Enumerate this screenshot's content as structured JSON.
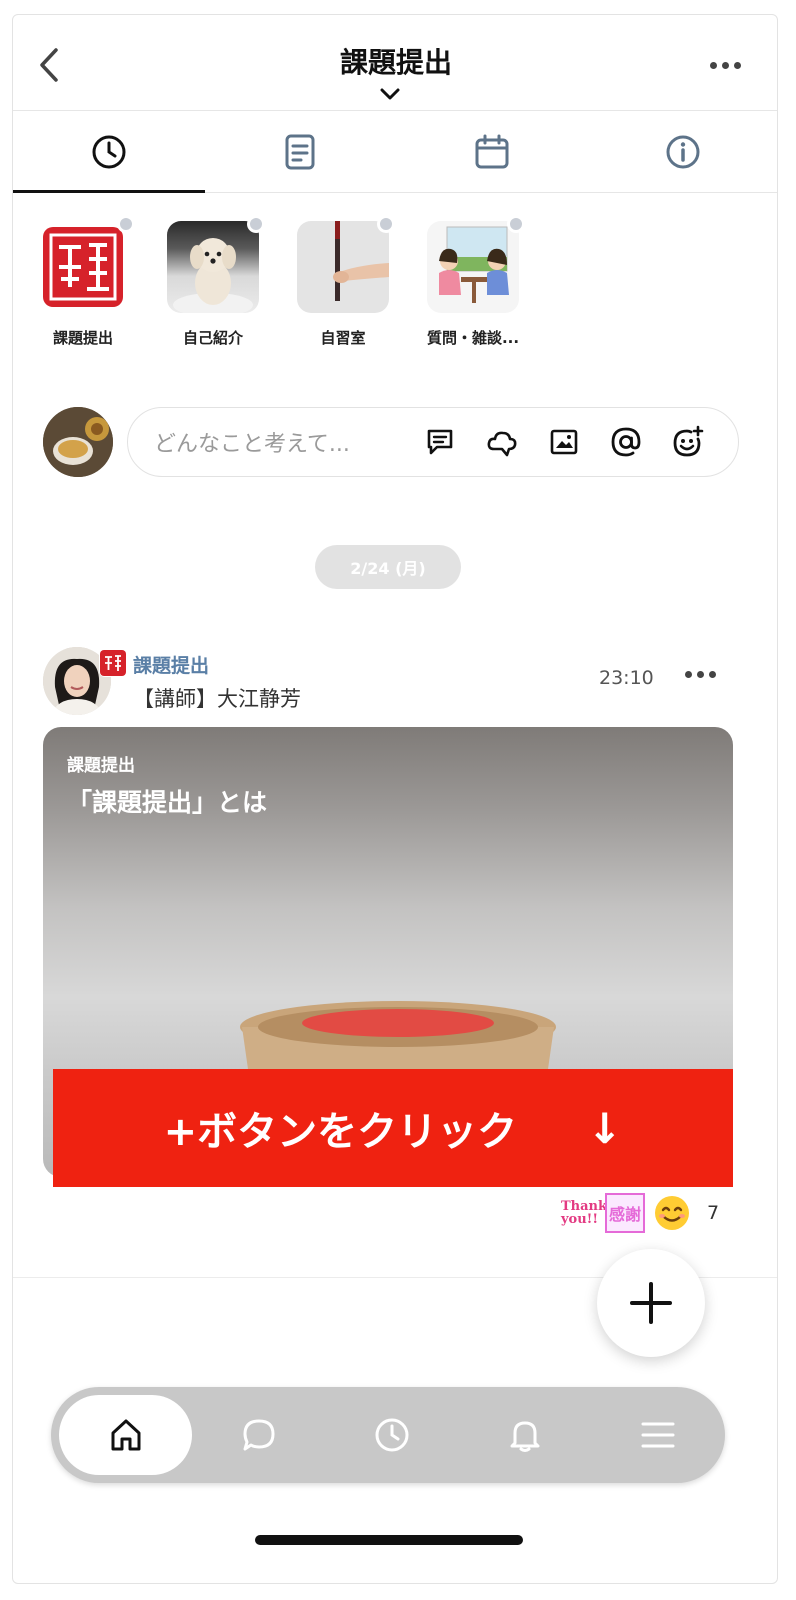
{
  "header": {
    "title": "課題提出",
    "back_icon": "chevron-left-icon",
    "more_icon": "more-horizontal-icon"
  },
  "tabs": [
    {
      "icon": "clock-icon",
      "active": true
    },
    {
      "icon": "document-icon",
      "active": false
    },
    {
      "icon": "calendar-icon",
      "active": false
    },
    {
      "icon": "info-icon",
      "active": false
    }
  ],
  "channels": [
    {
      "label": "課題提出"
    },
    {
      "label": "自己紹介"
    },
    {
      "label": "自習室"
    },
    {
      "label": "質問・雑談..."
    }
  ],
  "composer": {
    "placeholder": "どんなこと考えて...",
    "icons": [
      "message-icon",
      "cloud-icon",
      "image-icon",
      "at-icon",
      "emoji-add-icon"
    ]
  },
  "date_separator": "2/24 (月)",
  "post": {
    "channel": "課題提出",
    "author": "【講師】大江静芳",
    "time": "23:10",
    "card_kicker": "課題提出",
    "card_title": "「課題提出」とは",
    "reactions": {
      "thanks_line1": "Thank",
      "thanks_line2": "you!!",
      "kansha": "感謝",
      "count": "7"
    }
  },
  "cta": {
    "label": "+ボタンをクリック",
    "arrow": "↓",
    "color": "#ef2211"
  },
  "bottom_nav": [
    "home-icon",
    "chat-icon",
    "clock-icon",
    "bell-icon",
    "menu-icon"
  ]
}
